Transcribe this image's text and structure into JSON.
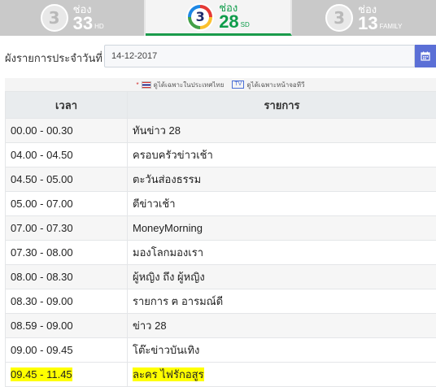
{
  "channels": [
    {
      "word": "ช่อง",
      "number": "33",
      "tag": "HD",
      "logo_num": "3",
      "active": false
    },
    {
      "word": "ช่อง",
      "number": "28",
      "tag": "SD",
      "logo_num": "3",
      "active": true
    },
    {
      "word": "ช่อง",
      "number": "13",
      "tag": "FAMILY",
      "logo_num": "3",
      "active": false
    }
  ],
  "date_label": "ผังรายการประจำวันที่",
  "date_value": "14-12-2017",
  "icons": {
    "calendar": "calendar-icon",
    "flag": "thai-flag-icon",
    "tv": "tv-icon"
  },
  "legend": {
    "thai_text": "ดูได้เฉพาะในประเทศไทย",
    "tv_badge": "TV",
    "tv_text": "ดูได้เฉพาะหน้าจอทีวี"
  },
  "table": {
    "headers": {
      "time": "เวลา",
      "program": "รายการ"
    },
    "rows": [
      {
        "time": "00.00 - 00.30",
        "program": "ทันข่าว 28"
      },
      {
        "time": "04.00 - 04.50",
        "program": "ครอบครัวข่าวเช้า"
      },
      {
        "time": "04.50 - 05.00",
        "program": "ตะวันส่องธรรม"
      },
      {
        "time": "05.00 - 07.00",
        "program": "ตีข่าวเช้า"
      },
      {
        "time": "07.00 - 07.30",
        "program": "MoneyMorning"
      },
      {
        "time": "07.30 - 08.00",
        "program": "มองโลกมองเรา"
      },
      {
        "time": "08.00 - 08.30",
        "program": "ผู้หญิง ถึง ผู้หญิง"
      },
      {
        "time": "08.30 - 09.00",
        "program": "รายการ ฅ อารมณ์ดี"
      },
      {
        "time": "08.59 - 09.00",
        "program": "ข่าว 28"
      },
      {
        "time": "09.00 - 09.45",
        "program": "โต๊ะข่าวบันเทิง"
      },
      {
        "time": "09.45 - 11.45",
        "program": "ละคร ไฟรักอสูร",
        "highlighted": true
      }
    ]
  },
  "colors": {
    "accent_green": "#1a9b4b",
    "calendar_button": "#5b6fd6",
    "highlight": "#ffff00"
  }
}
